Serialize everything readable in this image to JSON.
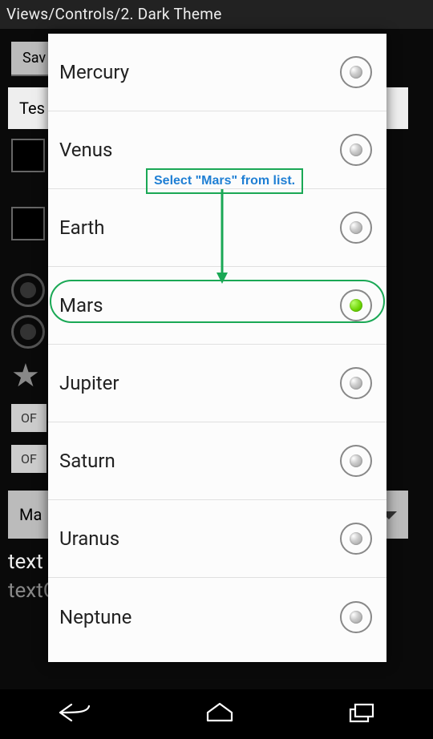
{
  "header": {
    "title": "Views/Controls/2. Dark Theme"
  },
  "background": {
    "save_btn": "Sav",
    "input_value": "Tes",
    "off1": "OF",
    "off2": "OF",
    "spinner_value": "Ma",
    "text1": "text",
    "text2": "textColorSecondary"
  },
  "dialog": {
    "options": [
      {
        "label": "Mercury",
        "selected": false
      },
      {
        "label": "Venus",
        "selected": false
      },
      {
        "label": "Earth",
        "selected": false
      },
      {
        "label": "Mars",
        "selected": true
      },
      {
        "label": "Jupiter",
        "selected": false
      },
      {
        "label": "Saturn",
        "selected": false
      },
      {
        "label": "Uranus",
        "selected": false
      },
      {
        "label": "Neptune",
        "selected": false
      }
    ]
  },
  "annotation": {
    "text": "Select \"Mars\" from list."
  }
}
